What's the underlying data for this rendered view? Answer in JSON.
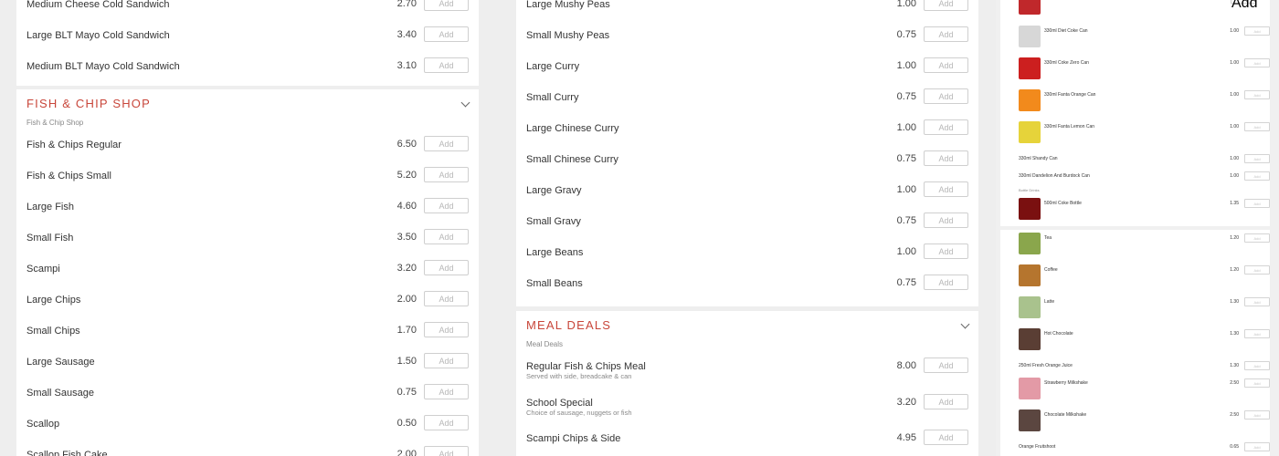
{
  "add_label": "Add",
  "col1": {
    "top_items": [
      {
        "name": "Medium Cheese Cold Sandwich",
        "price": "2.70"
      },
      {
        "name": "Large BLT Mayo Cold Sandwich",
        "price": "3.40"
      },
      {
        "name": "Medium BLT Mayo Cold Sandwich",
        "price": "3.10"
      }
    ],
    "section": {
      "title": "Fish & Chip Shop",
      "label": "Fish & Chip Shop",
      "items": [
        {
          "name": "Fish & Chips Regular",
          "price": "6.50"
        },
        {
          "name": "Fish & Chips Small",
          "price": "5.20"
        },
        {
          "name": "Large Fish",
          "price": "4.60"
        },
        {
          "name": "Small Fish",
          "price": "3.50"
        },
        {
          "name": "Scampi",
          "price": "3.20"
        },
        {
          "name": "Large Chips",
          "price": "2.00"
        },
        {
          "name": "Small Chips",
          "price": "1.70"
        },
        {
          "name": "Large Sausage",
          "price": "1.50"
        },
        {
          "name": "Small Sausage",
          "price": "0.75"
        },
        {
          "name": "Scallop",
          "price": "0.50"
        },
        {
          "name": "Scallop Fish Cake",
          "price": "2.00"
        }
      ]
    }
  },
  "col2": {
    "top_items": [
      {
        "name": "Large Mushy Peas",
        "price": "1.00"
      },
      {
        "name": "Small Mushy Peas",
        "price": "0.75"
      },
      {
        "name": "Large Curry",
        "price": "1.00"
      },
      {
        "name": "Small Curry",
        "price": "0.75"
      },
      {
        "name": "Large Chinese Curry",
        "price": "1.00"
      },
      {
        "name": "Small Chinese Curry",
        "price": "0.75"
      },
      {
        "name": "Large Gravy",
        "price": "1.00"
      },
      {
        "name": "Small Gravy",
        "price": "0.75"
      },
      {
        "name": "Large Beans",
        "price": "1.00"
      },
      {
        "name": "Small Beans",
        "price": "0.75"
      }
    ],
    "section": {
      "title": "Meal Deals",
      "label": "Meal Deals",
      "items": [
        {
          "name": "Regular Fish & Chips Meal",
          "desc": "Served with side, breadcake & can",
          "price": "8.00"
        },
        {
          "name": "School Special",
          "desc": "Choice of sausage, nuggets or fish",
          "price": "3.20"
        },
        {
          "name": "Scampi Chips & Side",
          "desc": "",
          "price": "4.95"
        }
      ]
    }
  },
  "col3": {
    "items": [
      {
        "name": "330ml Diet Coke Can",
        "price": "1.00",
        "color": "#d7d7d7"
      },
      {
        "name": "330ml Coke Zero Can",
        "price": "1.00",
        "color": "#cc1f1f"
      },
      {
        "name": "330ml Fanta Orange Can",
        "price": "1.00",
        "color": "#f28a1c"
      },
      {
        "name": "330ml Fanta Lemon Can",
        "price": "1.00",
        "color": "#e6d33a"
      },
      {
        "name": "330ml Shandy Can",
        "price": "1.00",
        "color": ""
      },
      {
        "name": "330ml Dandelion And Burdock Can",
        "price": "1.00",
        "color": ""
      },
      {
        "name": "500ml Coke Bottle",
        "price": "1.35",
        "color": "#7a1010"
      },
      {
        "name": "Tea",
        "price": "1.20",
        "color": "#8aa64c"
      },
      {
        "name": "Coffee",
        "price": "1.20",
        "color": "#b5752e"
      },
      {
        "name": "Latte",
        "price": "1.30",
        "color": "#a9c28d"
      },
      {
        "name": "Hot Chocolate",
        "price": "1.30",
        "color": "#5a3e34"
      },
      {
        "name": "250ml Fresh Orange Juice",
        "price": "1.30",
        "color": ""
      },
      {
        "name": "Strawberry Milkshake",
        "price": "2.50",
        "color": "#e39aa6"
      },
      {
        "name": "Chocolate Milkshake",
        "price": "2.50",
        "color": "#5b4640"
      },
      {
        "name": "Orange Fruitshoot",
        "price": "0.65",
        "color": ""
      }
    ],
    "label_bottle": "Bottle Drinks"
  }
}
